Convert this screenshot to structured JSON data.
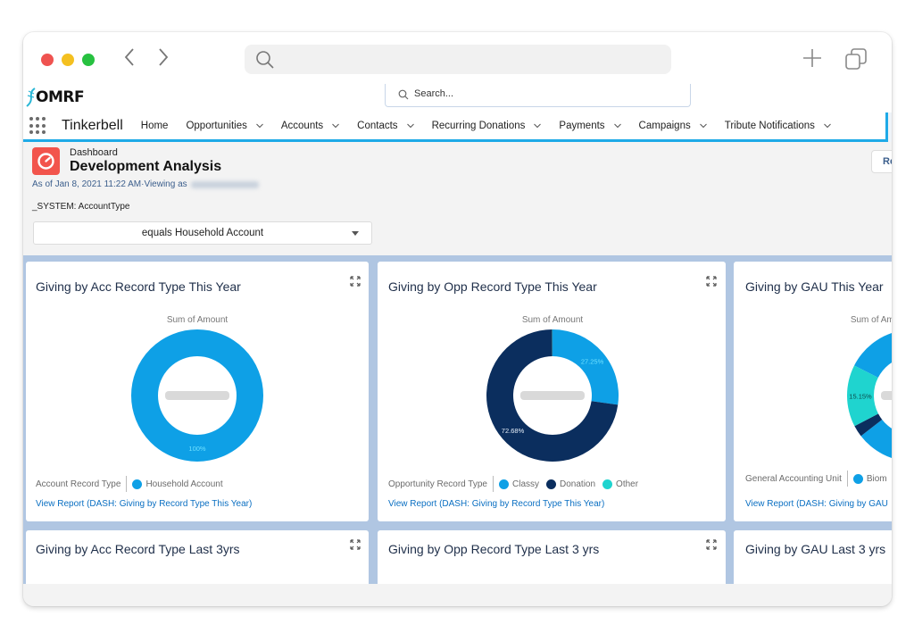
{
  "browser": {
    "back_icon": "chevron-left",
    "forward_icon": "chevron-right",
    "url_search_icon": "search-icon",
    "new_tab_icon": "plus-icon",
    "tabs_icon": "tabs-icon"
  },
  "org": {
    "logo_text": "OMRF",
    "search_placeholder": "Search..."
  },
  "nav": {
    "app_name": "Tinkerbell",
    "items": [
      {
        "label": "Home",
        "has_menu": false
      },
      {
        "label": "Opportunities",
        "has_menu": true
      },
      {
        "label": "Accounts",
        "has_menu": true
      },
      {
        "label": "Contacts",
        "has_menu": true
      },
      {
        "label": "Recurring Donations",
        "has_menu": true
      },
      {
        "label": "Payments",
        "has_menu": true
      },
      {
        "label": "Campaigns",
        "has_menu": true
      },
      {
        "label": "Tribute Notifications",
        "has_menu": true
      }
    ]
  },
  "dashboard": {
    "kicker": "Dashboard",
    "title": "Development Analysis",
    "as_of": "As of Jan 8, 2021 11:22 AM·Viewing as",
    "filter_label": "_SYSTEM: AccountType",
    "filter_value": "equals Household Account",
    "refresh_label": "Re"
  },
  "colors": {
    "classy": "#0ea0e6",
    "donation": "#0b2e5e",
    "other": "#1fd4cf",
    "link": "#0a6fc2",
    "nav_accent": "#1eaae7",
    "dash_icon": "#f2544c"
  },
  "cards": [
    {
      "title": "Giving by Acc Record Type This Year",
      "sum_label": "Sum of Amount",
      "legend_title": "Account Record Type",
      "legend": [
        {
          "label": "Household Account",
          "color": "#0ea0e6"
        }
      ],
      "view_report": "View Report (DASH: Giving by Record Type This Year)"
    },
    {
      "title": "Giving by Opp Record Type This Year",
      "sum_label": "Sum of Amount",
      "legend_title": "Opportunity Record Type",
      "legend": [
        {
          "label": "Classy",
          "color": "#0ea0e6"
        },
        {
          "label": "Donation",
          "color": "#0b2e5e"
        },
        {
          "label": "Other",
          "color": "#1fd4cf"
        }
      ],
      "view_report": "View Report (DASH: Giving by Record Type This Year)"
    },
    {
      "title": "Giving by GAU This Year",
      "sum_label": "Sum of Amount",
      "legend_title": "General Accounting Unit",
      "legend": [
        {
          "label": "Biom",
          "color": "#0ea0e6"
        }
      ],
      "view_report": "View Report (DASH: Giving by GAU"
    },
    {
      "title": "Giving by Acc Record Type Last 3yrs"
    },
    {
      "title": "Giving by Opp Record Type Last 3 yrs"
    },
    {
      "title": "Giving by GAU Last 3 yrs"
    }
  ],
  "chart_data": [
    {
      "type": "pie",
      "title": "Giving by Acc Record Type This Year",
      "subtitle": "Sum of Amount",
      "center_label": "(redacted)",
      "categories": [
        "Household Account"
      ],
      "values": [
        100
      ],
      "labels": [
        "100%"
      ],
      "colors": [
        "#0ea0e6"
      ]
    },
    {
      "type": "pie",
      "title": "Giving by Opp Record Type This Year",
      "subtitle": "Sum of Amount",
      "center_label": "(redacted)",
      "categories": [
        "Classy",
        "Donation",
        "Other"
      ],
      "values": [
        27.25,
        72.68,
        0.07
      ],
      "labels": [
        "27.25%",
        "72.68%",
        ""
      ],
      "colors": [
        "#0ea0e6",
        "#0b2e5e",
        "#1fd4cf"
      ]
    },
    {
      "type": "pie",
      "title": "Giving by GAU This Year",
      "subtitle": "Sum of Amount",
      "center_label": "(redacted)",
      "categories": [
        "Biom",
        "(dark segment)",
        "(teal segment)"
      ],
      "values": [
        82.0,
        2.85,
        15.15
      ],
      "labels": [
        "",
        "",
        "15.15%"
      ],
      "colors": [
        "#0ea0e6",
        "#0b2e5e",
        "#1fd4cf"
      ]
    }
  ]
}
